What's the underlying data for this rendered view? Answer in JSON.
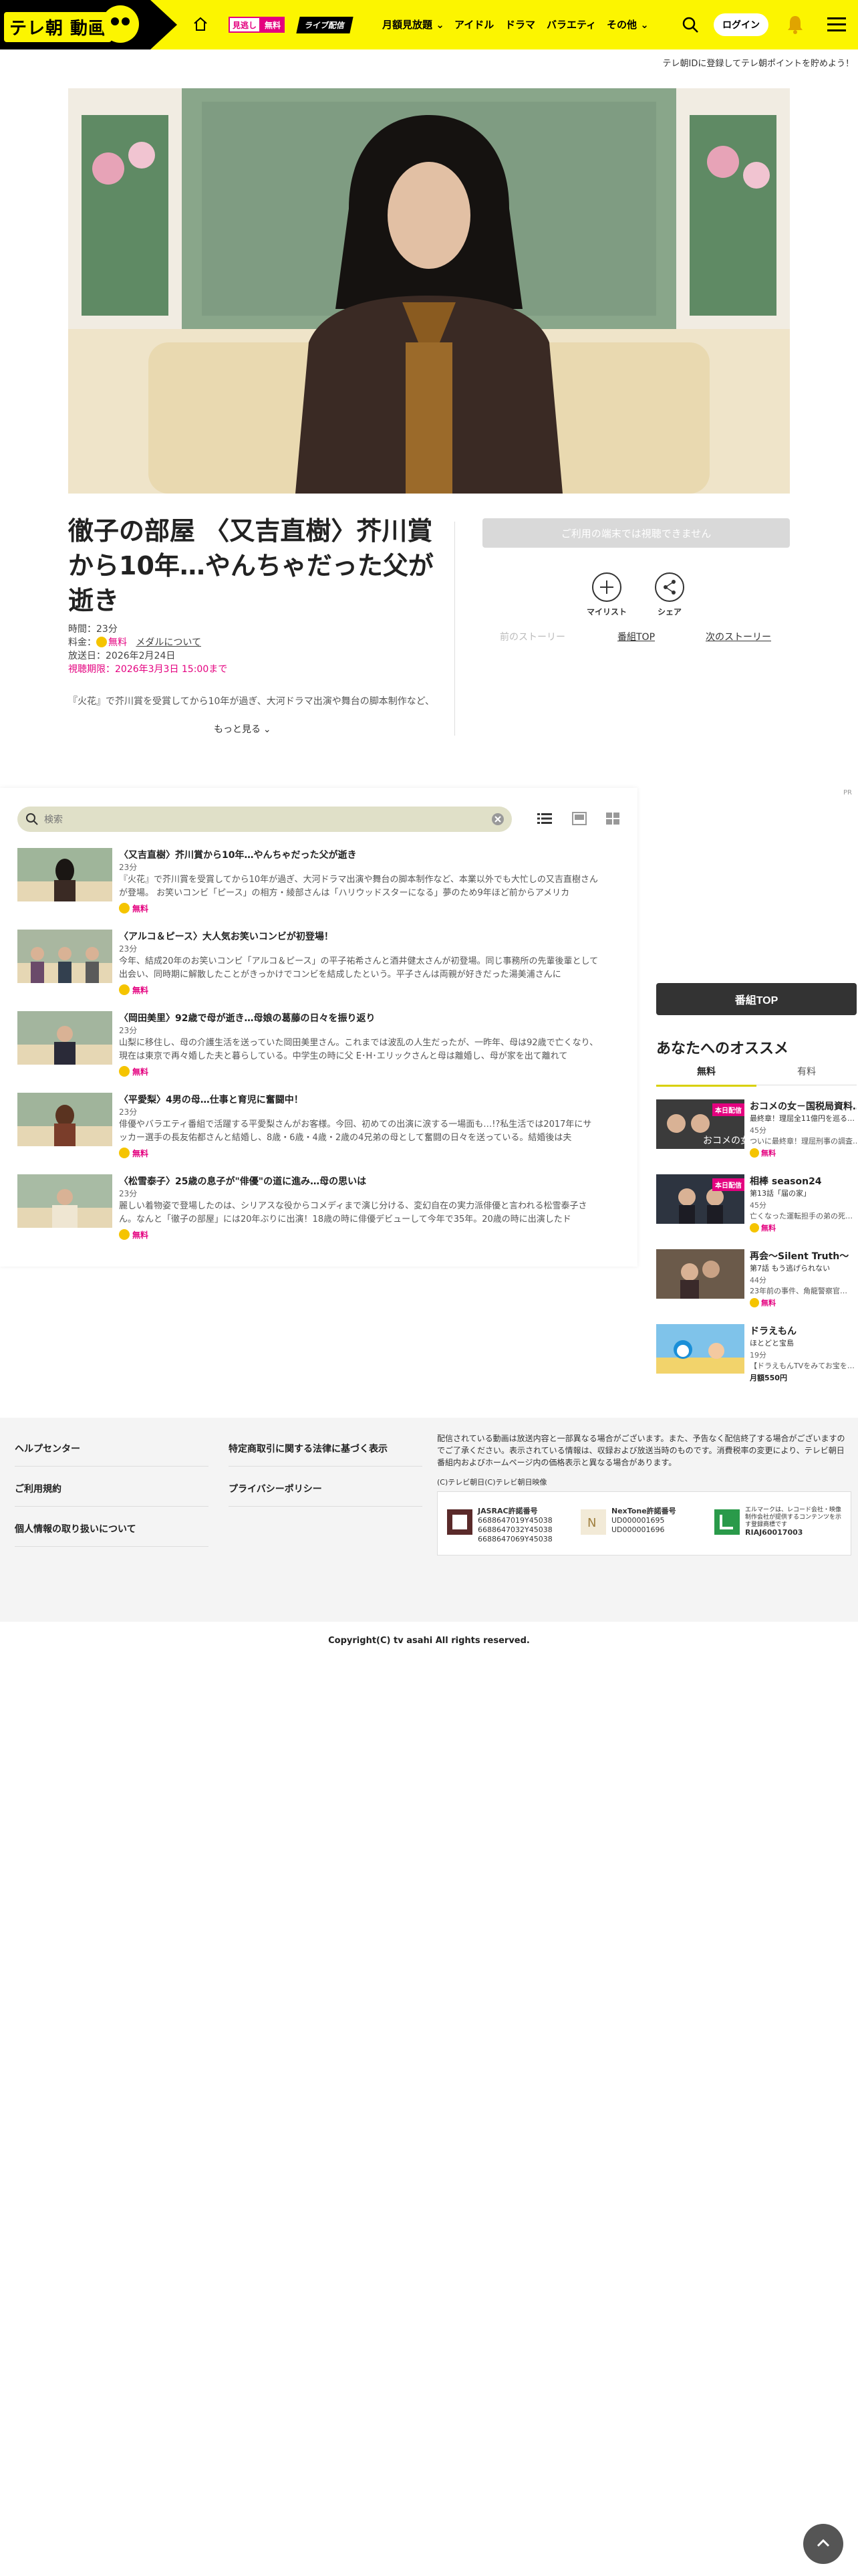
{
  "header": {
    "logo_text": "テレ朝 動画",
    "mitoshi_label": "見逃し",
    "free_label": "無料",
    "live_label": "ライブ配信",
    "nav": [
      {
        "label": "月額見放題",
        "has_chevron": true
      },
      {
        "label": "アイドル"
      },
      {
        "label": "ドラマ"
      },
      {
        "label": "バラエティ"
      },
      {
        "label": "その他",
        "has_chevron": true
      }
    ],
    "login_label": "ログイン",
    "register_message": "テレ朝IDに登録してテレ朝ポイントを貯めよう！"
  },
  "episode": {
    "title": "徹子の部屋 〈又吉直樹〉芥川賞から10年…やんちゃだった父が逝き",
    "duration": "時間：23分",
    "price_label": "料金：",
    "price_value": "無料",
    "membership_link": "メダルについて",
    "air_date": "放送日：2026年2月24日",
    "deadline": "視聴期限：2026年3月3日 15:00まで",
    "description": "『火花』で芥川賞を受賞してから10年が過ぎ、大河ドラマ出演や舞台の脚本制作など、本業",
    "more_label": "もっと見る"
  },
  "actions": {
    "cant_watch": "ご利用の端末では視聴できません",
    "mylist": "マイリスト",
    "share": "シェア",
    "prev_story": "前のストーリー",
    "program_top": "番組TOP",
    "next_story": "次のストーリー"
  },
  "playlist": {
    "search_placeholder": "検索",
    "items": [
      {
        "title": "〈又吉直樹〉芥川賞から10年…やんちゃだった父が逝き",
        "duration": "23分",
        "description": "『火花』で芥川賞を受賞してから10年が過ぎ、大河ドラマ出演や舞台の脚本制作など、本業以外でも大忙しの又吉直樹さんが登場。 お笑いコンビ「ピース」の相方・綾部さんは「ハリウッドスターになる」夢のため9年ほど前からアメリカ",
        "free": "無料"
      },
      {
        "title": "〈アルコ＆ピース〉大人気お笑いコンビが初登場！",
        "duration": "23分",
        "description": "今年、結成20年のお笑いコンビ「アルコ＆ピース」の平子祐希さんと酒井健太さんが初登場。同じ事務所の先輩後輩として出会い、同時期に解散したことがきっかけでコンビを結成したという。平子さんは両親が好きだった湯美浦さんに",
        "free": "無料"
      },
      {
        "title": "〈岡田美里〉92歳で母が逝き…母娘の葛藤の日々を振り返り",
        "duration": "23分",
        "description": "山梨に移住し、母の介護生活を送っていた岡田美里さん。これまでは波乱の人生だったが、一昨年、母は92歳で亡くなり、現在は東京で再々婚した夫と暮らしている。中学生の時に父 E･H･エリックさんと母は離婚し、母が家を出て離れて",
        "free": "無料"
      },
      {
        "title": "〈平愛梨〉4男の母…仕事と育児に奮闘中！",
        "duration": "23分",
        "description": "俳優やバラエティ番組で活躍する平愛梨さんがお客様。今回、初めての出演に涙する一場面も…!?私生活では2017年にサッカー選手の長友佑都さんと結婚し、8歳・6歳・4歳・2歳の4兄弟の母として奮闘の日々を送っている。結婚後は夫",
        "free": "無料"
      },
      {
        "title": "〈松雪泰子〉25歳の息子が\"俳優\"の道に進み…母の思いは",
        "duration": "23分",
        "description": "麗しい着物姿で登場したのは、シリアスな役からコメディまで演じ分ける、変幻自在の実力派俳優と言われる松雪泰子さん。なんと「徹子の部屋」には20年ぶりに出演！18歳の時に俳優デビューして今年で35年。20歳の時に出演したド",
        "free": "無料"
      }
    ]
  },
  "sidebar": {
    "pr": "PR",
    "program_top": "番組TOP",
    "reco_title": "あなたへのオススメ",
    "tab_free": "無料",
    "tab_paid": "有料",
    "items": [
      {
        "tag": "本日配信",
        "name": "おコメの女－国税局資料…",
        "sub": "最終章！理屈全11億円を巡る…",
        "duration": "45分",
        "desc": "ついに最終章！理屈刑事の調査…",
        "free": "無料"
      },
      {
        "tag": "本日配信",
        "name": "相棒 season24",
        "sub": "第13話「届の家」",
        "duration": "45分",
        "desc": "亡くなった運転担手の弟の死…",
        "free": "無料"
      },
      {
        "tag": "",
        "name": "再会～Silent Truth～",
        "sub": "第7話 もう逃げられない",
        "duration": "44分",
        "desc": "23年前の事件、角龍警察官…",
        "free": "無料"
      },
      {
        "tag": "",
        "name": "ドラえもん",
        "sub": "ほとどと宝島",
        "duration": "19分",
        "desc": "【ドラえもんTVをみてお宝を…",
        "free": "",
        "price": "月額550円"
      }
    ]
  },
  "footer": {
    "links_col1": [
      "ヘルプセンター",
      "ご利用規約",
      "個人情報の取り扱いについて"
    ],
    "links_col2": [
      "特定商取引に関する法律に基づく表示",
      "プライバシーポリシー"
    ],
    "note": "配信されている動画は放送内容と一部異なる場合がございます。また、予告なく配信終了する場合がございますのでご了承ください。表示されている情報は、収録および放送当時のものです。消費税率の変更により、テレビ朝日番組内およびホームページ内の価格表示と異なる場合があります。",
    "small_copyright": "(C)テレビ朝日(C)テレビ朝日映像",
    "jasrac_title": "JASRAC許諾番号",
    "jasrac_numbers": [
      "6688647019Y45038",
      "6688647032Y45038",
      "6688647069Y45038"
    ],
    "nextone_title": "NexTone許諾番号",
    "nextone_numbers": [
      "UD000001695",
      "UD000001696"
    ],
    "riaj_text": "エルマークは、レコード会社・映像制作会社が提供するコンテンツを示す登録商標です",
    "riaj_number": "RIAJ60017003",
    "copyright": "Copyright(C) tv asahi All rights reserved."
  },
  "colors": {
    "brand_yellow": "#fcf500",
    "accent_pink": "#e4007f",
    "dark": "#333333"
  }
}
